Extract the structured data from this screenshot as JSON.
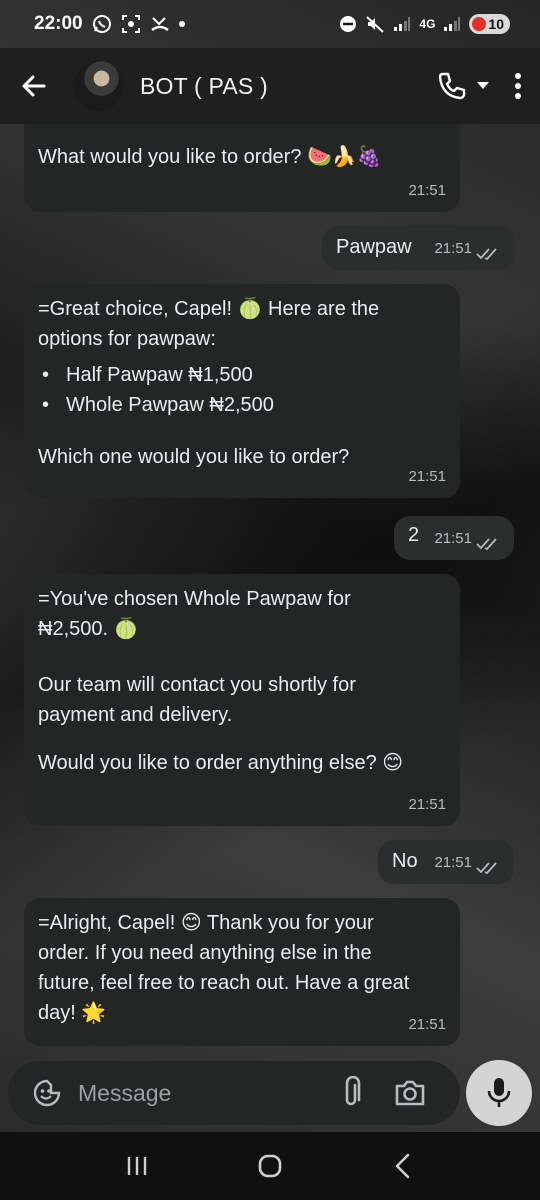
{
  "status_bar": {
    "time": "22:00",
    "network": "4G",
    "battery": "10",
    "battery_color": "#e0322a"
  },
  "header": {
    "contact_name": "BOT ( PAS )",
    "icons": [
      "back-arrow-icon",
      "avatar",
      "phone-icon",
      "dropdown-arrow-icon",
      "more-options-icon"
    ]
  },
  "messages": [
    {
      "direction": "in",
      "text": "What would you like to order? 🍉🍌🍇",
      "time": "21:51"
    },
    {
      "direction": "out",
      "text": "Pawpaw",
      "time": "21:51",
      "status": "read"
    },
    {
      "direction": "in",
      "text_intro": "=Great choice, Capel! 🍈 Here are the options for pawpaw:",
      "options": [
        "Half Pawpaw ₦1,500",
        "Whole Pawpaw ₦2,500"
      ],
      "text_outro": "Which one would you like to order?",
      "time": "21:51"
    },
    {
      "direction": "out",
      "text": "2",
      "time": "21:51",
      "status": "read"
    },
    {
      "direction": "in",
      "text_line1": "=You've chosen Whole Pawpaw for ₦2,500. 🍈",
      "text_line2": "Our team will contact you shortly for payment and delivery.",
      "text_line3": "Would you like to order anything else? 😊",
      "time": "21:51"
    },
    {
      "direction": "out",
      "text": "No",
      "time": "21:51",
      "status": "read"
    },
    {
      "direction": "in",
      "text": "=Alright, Capel! 😊 Thank you for your order. If you need anything else in the future, feel free to reach out. Have a great day! 🌟",
      "time": "21:51"
    }
  ],
  "composer": {
    "placeholder": "Message",
    "icons": [
      "emoji-sticker-icon",
      "attach-icon",
      "camera-icon",
      "mic-icon"
    ]
  },
  "nav_bar": {
    "icons": [
      "recent-apps-icon",
      "home-icon",
      "back-icon"
    ]
  },
  "colors": {
    "incoming_bubble": "#242626",
    "outgoing_bubble": "#2c2e2e",
    "header": "#1f1f1f",
    "read_ticks": "#b9bcbd"
  }
}
